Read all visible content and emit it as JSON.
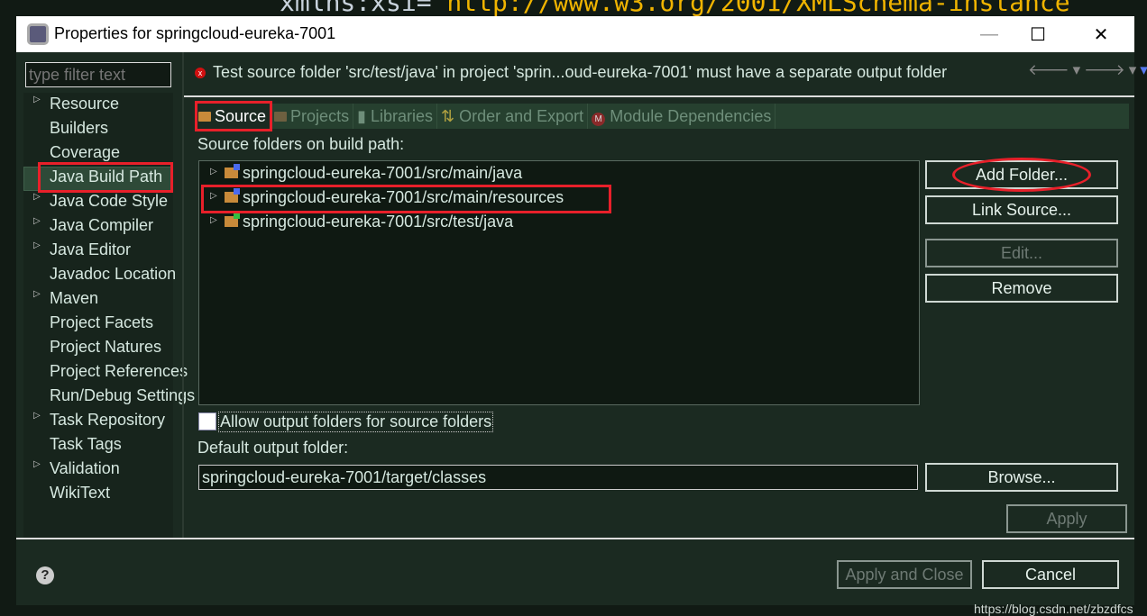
{
  "background_code": {
    "prefix": "xmlns:xsi=",
    "value": "\"http://www.w3.org/2001/XMLSchema-instance\""
  },
  "window": {
    "title": "Properties for springcloud-eureka-7001",
    "minimize": "—",
    "maximize": "☐",
    "close": "✕"
  },
  "filter": {
    "placeholder": "type filter text"
  },
  "sidebar": {
    "items": [
      {
        "label": "Resource",
        "expandable": true
      },
      {
        "label": "Builders",
        "expandable": false
      },
      {
        "label": "Coverage",
        "expandable": false
      },
      {
        "label": "Java Build Path",
        "expandable": false,
        "selected": true
      },
      {
        "label": "Java Code Style",
        "expandable": true
      },
      {
        "label": "Java Compiler",
        "expandable": true
      },
      {
        "label": "Java Editor",
        "expandable": true
      },
      {
        "label": "Javadoc Location",
        "expandable": false
      },
      {
        "label": "Maven",
        "expandable": true
      },
      {
        "label": "Project Facets",
        "expandable": false
      },
      {
        "label": "Project Natures",
        "expandable": false
      },
      {
        "label": "Project References",
        "expandable": false
      },
      {
        "label": "Run/Debug Settings",
        "expandable": false
      },
      {
        "label": "Task Repository",
        "expandable": true
      },
      {
        "label": "Task Tags",
        "expandable": false
      },
      {
        "label": "Validation",
        "expandable": true
      },
      {
        "label": "WikiText",
        "expandable": false
      }
    ]
  },
  "message": {
    "icon": "error-icon",
    "text": "Test source folder 'src/test/java' in project 'sprin...oud-eureka-7001' must have a separate output folder"
  },
  "tabs": [
    {
      "label": "Source",
      "active": true
    },
    {
      "label": "Projects"
    },
    {
      "label": "Libraries"
    },
    {
      "label": "Order and Export"
    },
    {
      "label": "Module Dependencies"
    }
  ],
  "source": {
    "label": "Source folders on build path:",
    "folders": [
      "springcloud-eureka-7001/src/main/java",
      "springcloud-eureka-7001/src/main/resources",
      "springcloud-eureka-7001/src/test/java"
    ],
    "buttons": {
      "add": "Add Folder...",
      "link": "Link Source...",
      "edit": "Edit...",
      "remove": "Remove"
    },
    "allow_output_label": "Allow output folders for source folders",
    "allow_output_checked": false,
    "default_output_label": "Default output folder:",
    "default_output_value": "springcloud-eureka-7001/target/classes",
    "browse": "Browse...",
    "apply": "Apply"
  },
  "footer": {
    "apply_close": "Apply and Close",
    "cancel": "Cancel",
    "help": "?"
  },
  "watermark": "https://blog.csdn.net/zbzdfcs",
  "colors": {
    "annotation": "#e8202a",
    "background": "#1b2a21"
  }
}
